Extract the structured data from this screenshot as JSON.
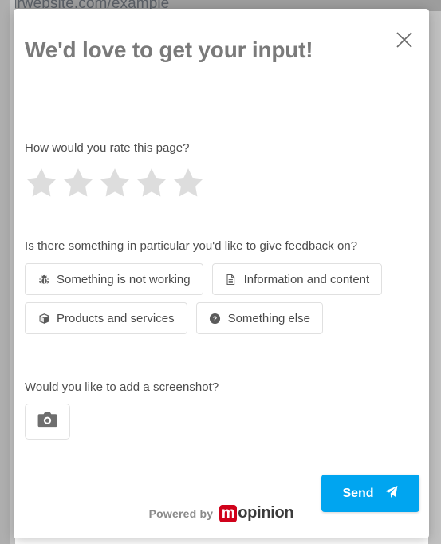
{
  "background": {
    "url_text": "ourwebsite.com/example"
  },
  "modal": {
    "title": "We'd love to get your input!",
    "close_icon": "close-x-icon",
    "rating": {
      "question": "How would you rate this page?",
      "star_count": 5,
      "selected": 0,
      "star_color": "#dddddd",
      "stars": [
        {
          "value": 1,
          "filled": false
        },
        {
          "value": 2,
          "filled": false
        },
        {
          "value": 3,
          "filled": false
        },
        {
          "value": 4,
          "filled": false
        },
        {
          "value": 5,
          "filled": false
        }
      ]
    },
    "category": {
      "question": "Is there something in particular you'd like to give feedback on?",
      "rows": [
        [
          {
            "label": "Something is not working",
            "icon": "bug-icon"
          },
          {
            "label": "Information and content",
            "icon": "document-icon"
          }
        ],
        [
          {
            "label": "Products and services",
            "icon": "cube-icon"
          },
          {
            "label": "Something else",
            "icon": "question-circle-icon"
          }
        ]
      ]
    },
    "screenshot": {
      "question": "Would you like to add a screenshot?",
      "button_icon": "camera-icon"
    },
    "submit": {
      "label": "Send",
      "icon": "paper-plane-icon",
      "color": "#00a5f0"
    },
    "footer": {
      "powered_by": "Powered by",
      "brand_mark": "m",
      "brand_name": "opinion",
      "brand_color": "#d0021b"
    }
  }
}
